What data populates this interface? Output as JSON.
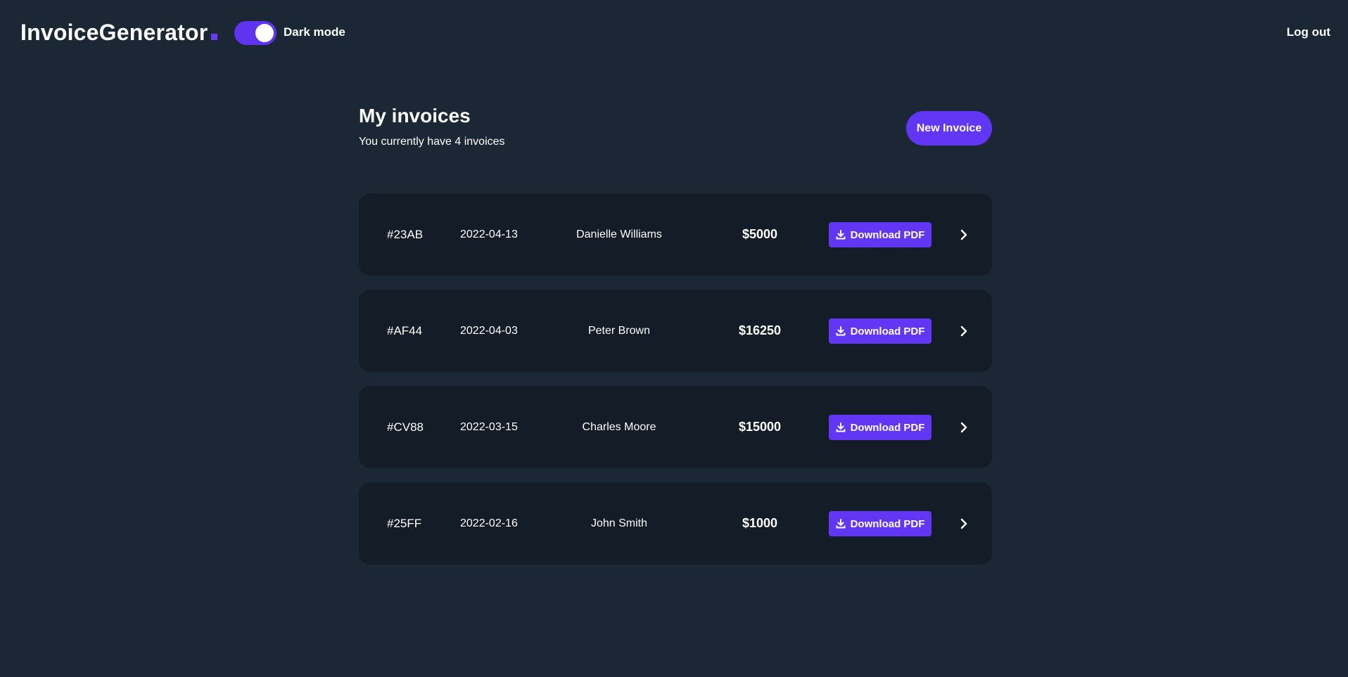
{
  "app": {
    "logo_text": "InvoiceGenerator",
    "dark_mode_label": "Dark mode",
    "dark_mode_on": true,
    "logout_label": "Log out"
  },
  "colors": {
    "background": "#1b2735",
    "card": "#141d27",
    "accent": "#6236f5",
    "text": "#ffffff"
  },
  "page": {
    "title": "My invoices",
    "subtitle": "You currently have 4 invoices",
    "new_invoice_label": "New Invoice"
  },
  "invoices": [
    {
      "id": "#23AB",
      "date": "2022-04-13",
      "client": "Danielle Williams",
      "amount": "$5000",
      "download_label": "Download PDF"
    },
    {
      "id": "#AF44",
      "date": "2022-04-03",
      "client": "Peter Brown",
      "amount": "$16250",
      "download_label": "Download PDF"
    },
    {
      "id": "#CV88",
      "date": "2022-03-15",
      "client": "Charles Moore",
      "amount": "$15000",
      "download_label": "Download PDF"
    },
    {
      "id": "#25FF",
      "date": "2022-02-16",
      "client": "John Smith",
      "amount": "$1000",
      "download_label": "Download PDF"
    }
  ],
  "icons": {
    "download": "download-icon",
    "open": "chevron-right-icon"
  }
}
